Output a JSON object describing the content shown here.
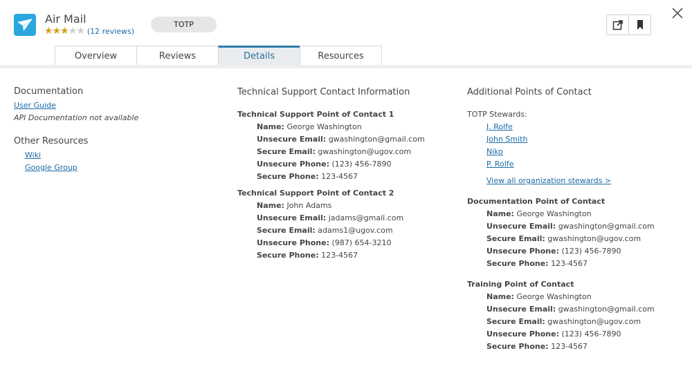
{
  "header": {
    "app_name": "Air Mail",
    "rating": 3,
    "rating_max": 5,
    "reviews_label": "(12 reviews)",
    "tag": "TOTP",
    "accent_color": "#2aa8de"
  },
  "toolbar": {
    "icons": [
      "external-link-icon",
      "bookmark-icon",
      "close-icon"
    ]
  },
  "tabs": [
    {
      "label": "Overview",
      "active": false
    },
    {
      "label": "Reviews",
      "active": false
    },
    {
      "label": "Details",
      "active": true
    },
    {
      "label": "Resources",
      "active": false
    }
  ],
  "documentation": {
    "title": "Documentation",
    "user_guide": "User Guide",
    "api_note": "API Documentation not available"
  },
  "other_resources": {
    "title": "Other Resources",
    "links": [
      "Wiki",
      "Google Group"
    ]
  },
  "tech_support": {
    "title": "Technical Support Contact Information",
    "contacts": [
      {
        "heading": "Technical Support Point of Contact 1",
        "name": "George Washington",
        "unsecure_email": "gwashington@gmail.com",
        "secure_email": "gwashington@ugov.com",
        "unsecure_phone": "(123) 456-7890",
        "secure_phone": "123-4567"
      },
      {
        "heading": "Technical Support Point of Contact 2",
        "name": "John Adams",
        "unsecure_email": "jadams@gmail.com",
        "secure_email": "adams1@ugov.com",
        "unsecure_phone": "(987) 654-3210",
        "secure_phone": "123-4567"
      }
    ]
  },
  "labels": {
    "name": "Name:",
    "unsecure_email": "Unsecure Email:",
    "secure_email": "Secure Email:",
    "unsecure_phone": "Unsecure Phone:",
    "secure_phone": "Secure Phone:"
  },
  "additional": {
    "title": "Additional Points of Contact",
    "stewards_label": "TOTP Stewards:",
    "stewards": [
      "J. Rolfe",
      "John Smith",
      "Niko",
      "P. Rolfe"
    ],
    "view_all": "View all organization stewards >",
    "documentation_poc": {
      "heading": "Documentation Point of Contact",
      "name": "George Washington",
      "unsecure_email": "gwashington@gmail.com",
      "secure_email": "gwashington@ugov.com",
      "unsecure_phone": "(123) 456-7890",
      "secure_phone": "123-4567"
    },
    "training_poc": {
      "heading": "Training Point of Contact",
      "name": "George Washington",
      "unsecure_email": "gwashington@gmail.com",
      "secure_email": "gwashington@ugov.com",
      "unsecure_phone": "(123) 456-7890",
      "secure_phone": "123-4567"
    }
  }
}
